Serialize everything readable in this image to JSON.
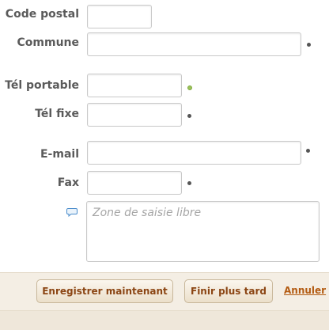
{
  "form": {
    "fields": {
      "postal_code": {
        "label": "Code postal",
        "value": ""
      },
      "commune": {
        "label": "Commune",
        "value": ""
      },
      "mobile": {
        "label": "Tél portable",
        "value": ""
      },
      "landline": {
        "label": "Tél fixe",
        "value": ""
      },
      "email": {
        "label": "E-mail",
        "value": ""
      },
      "fax": {
        "label": "Fax",
        "value": ""
      }
    },
    "notes": {
      "placeholder": "Zone de saisie libre",
      "value": ""
    }
  },
  "actions": {
    "save_now": "Enregistrer maintenant",
    "finish_later": "Finir plus tard",
    "cancel": "Annuler"
  },
  "colors": {
    "required_dot": "#555555",
    "valid_dot": "#9cc35a",
    "button_text": "#8b4513",
    "link": "#b35b12"
  },
  "icons": {
    "notes": "speech-bubble-icon",
    "required": "required-dot-icon",
    "valid": "valid-dot-icon"
  }
}
